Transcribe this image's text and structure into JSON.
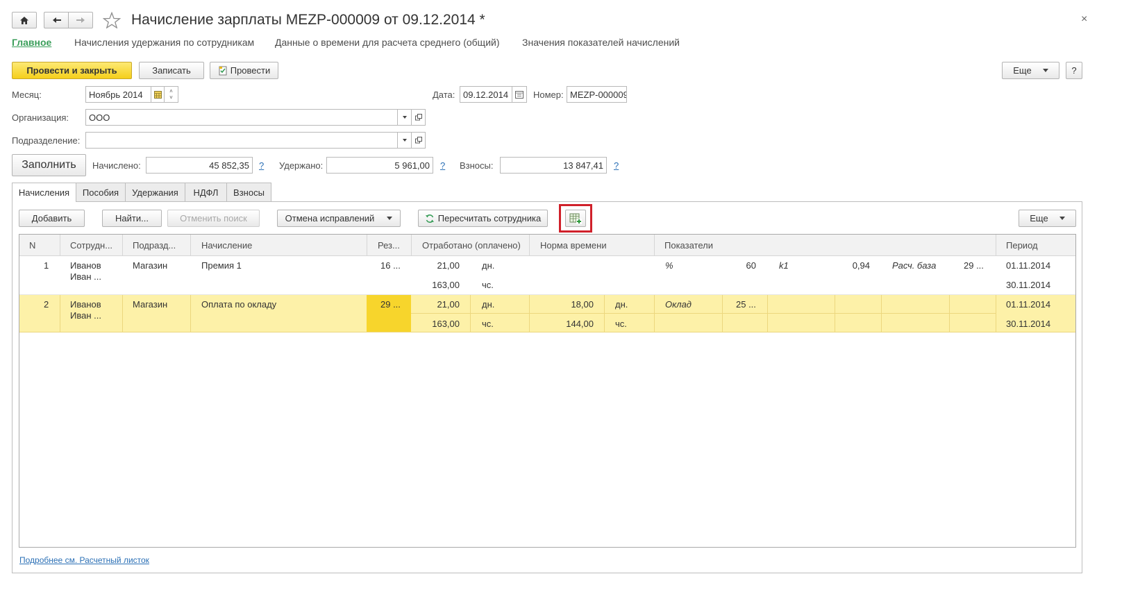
{
  "title": "Начисление зарплаты MEZP-000009 от 09.12.2014 *",
  "nav": {
    "main": "Главное",
    "link1": "Начисления удержания по сотрудникам",
    "link2": "Данные о времени для расчета среднего (общий)",
    "link3": "Значения показателей начислений"
  },
  "toolbar": {
    "post_close": "Провести и закрыть",
    "save": "Записать",
    "post": "Провести",
    "more": "Еще",
    "help": "?"
  },
  "form": {
    "month_label": "Месяц:",
    "month_value": "Ноябрь 2014",
    "date_label": "Дата:",
    "date_value": "09.12.2014",
    "number_label": "Номер:",
    "number_value": "MEZP-000009",
    "org_label": "Организация:",
    "org_value": "ООО",
    "dept_label": "Подразделение:",
    "dept_value": "",
    "fill_button": "Заполнить",
    "accrued_label": "Начислено:",
    "accrued_value": "45 852,35",
    "withheld_label": "Удержано:",
    "withheld_value": "5 961,00",
    "contrib_label": "Взносы:",
    "contrib_value": "13 847,41",
    "help_mark": "?"
  },
  "tabs": [
    "Начисления",
    "Пособия",
    "Удержания",
    "НДФЛ",
    "Взносы"
  ],
  "table_toolbar": {
    "add": "Добавить",
    "find": "Найти...",
    "cancel_search": "Отменить поиск",
    "cancel_fix": "Отмена исправлений",
    "recalc": "Пересчитать сотрудника",
    "more": "Еще"
  },
  "columns": {
    "n": "N",
    "employee": "Сотрудн...",
    "dept": "Подразд...",
    "accrual": "Начисление",
    "result": "Рез...",
    "worked": "Отработано (оплачено)",
    "norm": "Норма времени",
    "indicators": "Показатели",
    "period": "Период"
  },
  "rows": [
    {
      "n": "1",
      "employee_l1": "Иванов",
      "employee_l2": "Иван ...",
      "dept": "Магазин",
      "accrual": "Премия 1",
      "result": "16 ...",
      "worked_days": "21,00",
      "days_unit": "дн.",
      "worked_hours": "163,00",
      "hours_unit": "чс.",
      "norm_days": "",
      "norm_days_unit": "",
      "norm_hours": "",
      "norm_hours_unit": "",
      "ind1_name": "%",
      "ind1_value": "60",
      "ind2_name": "k1",
      "ind2_value": "0,94",
      "ind3_name": "Расч. база",
      "ind3_value": "29 ...",
      "period_start": "01.11.2014",
      "period_end": "30.11.2014"
    },
    {
      "n": "2",
      "employee_l1": "Иванов",
      "employee_l2": "Иван ...",
      "dept": "Магазин",
      "accrual": "Оплата по окладу",
      "result": "29 ...",
      "worked_days": "21,00",
      "days_unit": "дн.",
      "worked_hours": "163,00",
      "hours_unit": "чс.",
      "norm_days": "18,00",
      "norm_days_unit": "дн.",
      "norm_hours": "144,00",
      "norm_hours_unit": "чс.",
      "ind1_name": "Оклад",
      "ind1_value": "25 ...",
      "period_start": "01.11.2014",
      "period_end": "30.11.2014"
    }
  ],
  "footer_link": "Подробнее см. Расчетный листок",
  "colors": {
    "accent_yellow": "#f5cf1a",
    "selected_row": "#fdf1a8",
    "selected_cell": "#f7d52c",
    "highlight_frame": "#d0202a",
    "link_green": "#3a9e5a"
  }
}
